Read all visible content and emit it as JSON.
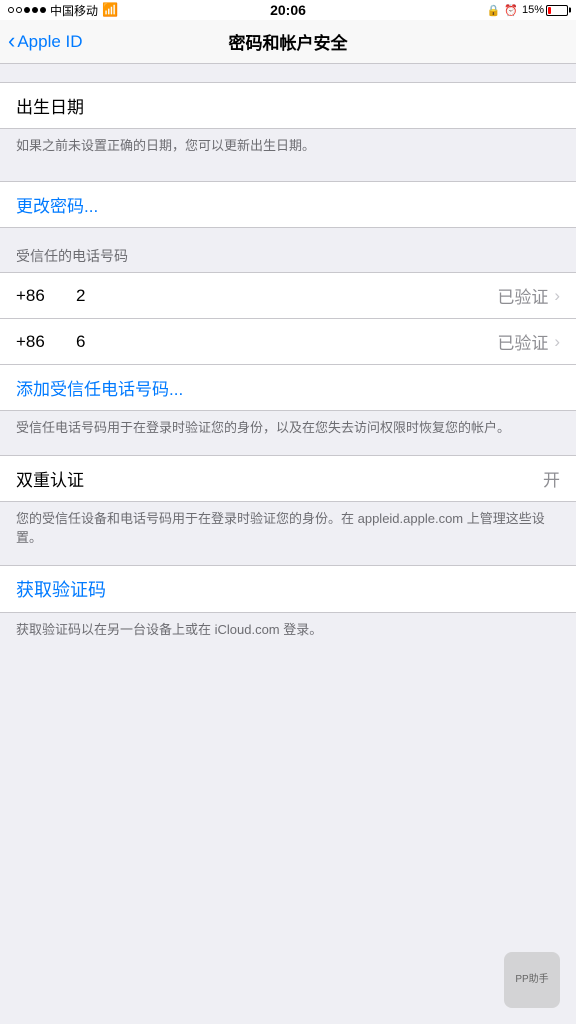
{
  "statusBar": {
    "carrier": "中国移动",
    "time": "20:06",
    "battery": "15%"
  },
  "navBar": {
    "backLabel": "Apple ID",
    "title": "密码和帐户安全"
  },
  "birthDate": {
    "sectionTitle": "出生日期",
    "description": "如果之前未设置正确的日期，您可以更新出生日期。"
  },
  "changePassword": {
    "label": "更改密码..."
  },
  "trustedPhone": {
    "sectionHeader": "受信任的电话号码",
    "phones": [
      {
        "code": "+86",
        "number": "2",
        "status": "已验证"
      },
      {
        "code": "+86",
        "number": "6",
        "status": "已验证"
      }
    ],
    "addLabel": "添加受信任电话号码...",
    "footer": "受信任电话号码用于在登录时验证您的身份，以及在您失去访问权限时恢复您的帐户。"
  },
  "twoFactor": {
    "label": "双重认证",
    "value": "开",
    "footer": "您的受信任设备和电话号码用于在登录时验证您的身份。在 appleid.apple.com 上管理这些设置。"
  },
  "getCode": {
    "label": "获取验证码",
    "footer": "获取验证码以在另一台设备上或在 iCloud.com 登录。"
  },
  "watermark": "PP助手"
}
